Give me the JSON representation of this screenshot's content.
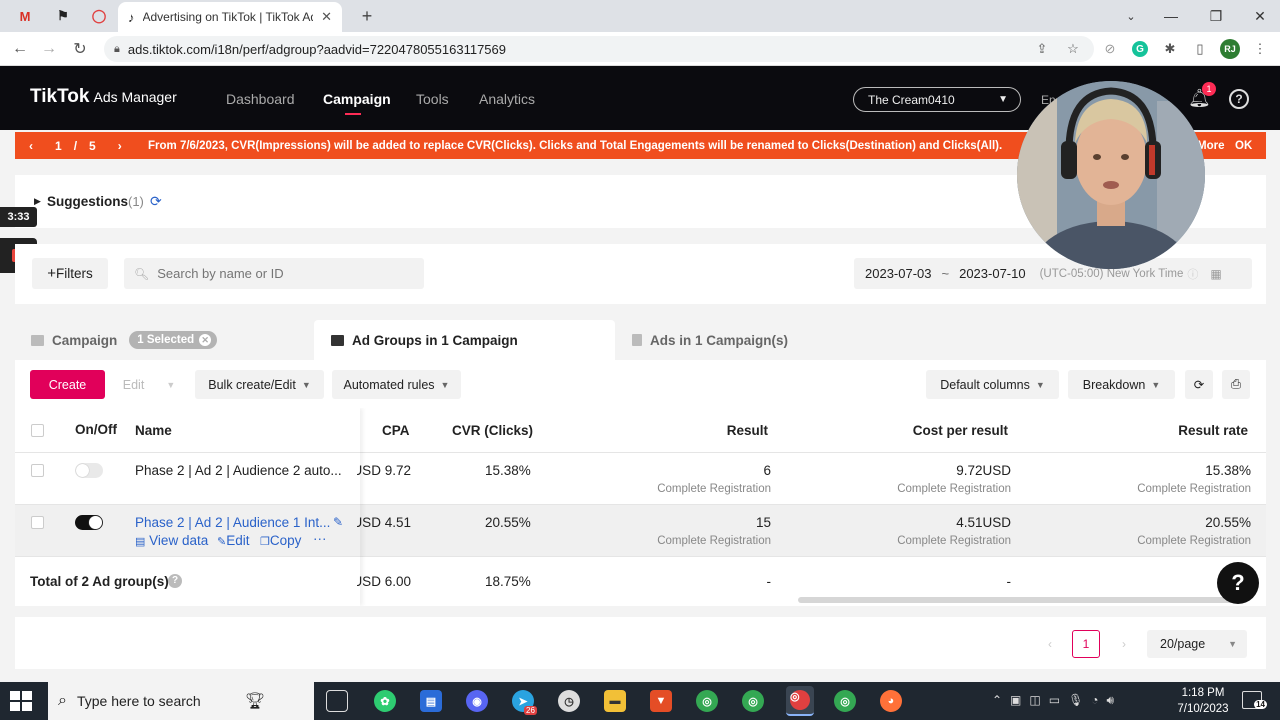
{
  "browser": {
    "tab_title": "Advertising on TikTok | TikTok Ads",
    "url": "ads.tiktok.com/i18n/perf/adgroup?aadvid=7220478055163117569",
    "profile_initials": "RJ"
  },
  "app": {
    "logo": "TikTok",
    "logo_sub": "Ads Manager",
    "nav": [
      "Dashboard",
      "Campaign",
      "Tools",
      "Analytics"
    ],
    "account": "The Cream0410",
    "language": "En",
    "notifications": "1"
  },
  "notice": {
    "current": "1",
    "sep": "/",
    "total": "5",
    "message": "From 7/6/2023, CVR(Impressions) will be added to replace CVR(Clicks). Clicks and Total Engagements will be renamed to Clicks(Destination) and Clicks(All).",
    "more": "More",
    "ok": "OK"
  },
  "suggestions": {
    "label": "Suggestions",
    "count": "(1)"
  },
  "recording": {
    "timer": "3:33"
  },
  "filterbar": {
    "filters_label": "Filters",
    "search_placeholder": "Search by name or ID",
    "date_start": "2023-07-03",
    "date_sep": "~",
    "date_end": "2023-07-10",
    "timezone": "(UTC-05:00) New York Time"
  },
  "tabs": {
    "campaign": "Campaign",
    "selected_chip": "1 Selected",
    "adgroups": "Ad Groups in 1 Campaign",
    "ads": "Ads in 1 Campaign(s)"
  },
  "toolbar": {
    "create": "Create",
    "edit": "Edit",
    "bulk": "Bulk create/Edit",
    "rules": "Automated rules",
    "columns": "Default columns",
    "breakdown": "Breakdown"
  },
  "table": {
    "headers": {
      "onoff": "On/Off",
      "name": "Name",
      "cpa": "CPA",
      "cvr": "CVR (Clicks)",
      "result": "Result",
      "cpr": "Cost per result",
      "rate": "Result rate"
    },
    "rows": [
      {
        "name": "Phase 2 | Ad 2 | Audience 2 auto...",
        "cpa": "9.72 USD",
        "cvr": "15.38%",
        "result": "6",
        "result_sub": "Complete Registration",
        "cpr": "9.72USD",
        "cpr_sub": "Complete Registration",
        "rate": "15.38%",
        "rate_sub": "Complete Registration"
      },
      {
        "name": "Phase 2 | Ad 2 | Audience 1 Int...",
        "cpa": "4.51 USD",
        "cvr": "20.55%",
        "result": "15",
        "result_sub": "Complete Registration",
        "cpr": "4.51USD",
        "cpr_sub": "Complete Registration",
        "rate": "20.55%",
        "rate_sub": "Complete Registration",
        "actions": {
          "view": "View data",
          "edit": "Edit",
          "copy": "Copy",
          "more": "···"
        }
      }
    ],
    "total": {
      "label": "Total of 2 Ad group(s)",
      "cpa": "6.00 USD",
      "cvr": "18.75%",
      "result": "-",
      "cpr": "-"
    }
  },
  "pager": {
    "current": "1",
    "page_size": "20/page"
  },
  "taskbar": {
    "search_placeholder": "Type here to search",
    "time": "1:18 PM",
    "date": "7/10/2023",
    "notif_count": "14",
    "telegram_badge": "26"
  },
  "colors": {
    "brand": "#e1005a",
    "notice": "#f04e1e",
    "link": "#2a62c9",
    "header": "#0b0b0f"
  },
  "icons": [
    "gmail-icon",
    "flag-icon",
    "opera-icon",
    "tiktok-icon",
    "back-icon",
    "forward-icon",
    "reload-icon",
    "lock-icon",
    "share-icon",
    "star-icon",
    "extensions-icon",
    "bell-icon",
    "help-icon",
    "refresh-icon",
    "search-icon",
    "calendar-icon",
    "export-icon",
    "windows-icon"
  ]
}
